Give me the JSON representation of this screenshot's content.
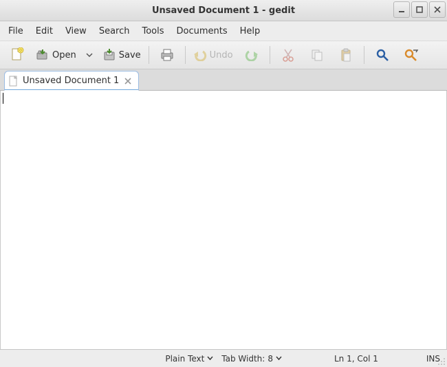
{
  "title": "Unsaved Document 1 - gedit",
  "menu": {
    "file": "File",
    "edit": "Edit",
    "view": "View",
    "search": "Search",
    "tools": "Tools",
    "documents": "Documents",
    "help": "Help"
  },
  "toolbar": {
    "open_label": "Open",
    "save_label": "Save",
    "undo_label": "Undo"
  },
  "tab": {
    "label": "Unsaved Document 1"
  },
  "status": {
    "language": "Plain Text",
    "tabwidth_label": "Tab Width:",
    "tabwidth_value": "8",
    "position": "Ln 1, Col 1",
    "mode": "INS"
  }
}
